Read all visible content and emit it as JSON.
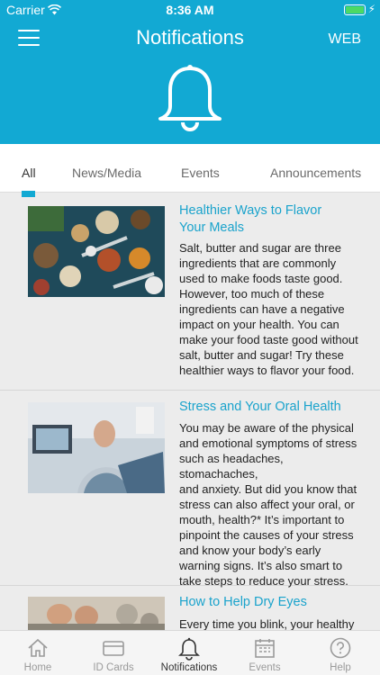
{
  "status_bar": {
    "carrier": "Carrier",
    "time": "8:36 AM"
  },
  "header": {
    "title": "Notifications",
    "web_label": "WEB",
    "colors": {
      "header_bg": "#12a9d3",
      "accent": "#1aa3cc"
    }
  },
  "tabs": [
    {
      "label": "All",
      "active": true
    },
    {
      "label": "News/Media",
      "active": false
    },
    {
      "label": "Events",
      "active": false
    },
    {
      "label": "Announcements",
      "active": false
    }
  ],
  "articles": [
    {
      "title_lines": [
        "Healthier Ways to Flavor",
        "Your Meals"
      ],
      "body_lines": [
        "Salt, butter and sugar are three",
        "ingredients that are commonly",
        "used to make foods taste good.",
        "However, too much of these",
        "ingredients can have a negative",
        "impact on your health. You can",
        "make your food taste good without",
        "salt, butter and sugar! Try these",
        "healthier ways to flavor your food."
      ],
      "image": "spices-photo"
    },
    {
      "title_lines": [
        "Stress and Your Oral Health"
      ],
      "body_lines": [
        "You may be aware of the physical",
        "and emotional symptoms of stress",
        "such as headaches, stomachaches,",
        "and anxiety. But did you know that",
        "stress can also affect your oral, or",
        "mouth, health?* It’s important to",
        "pinpoint the causes of your stress",
        "and know your body’s early",
        "warning signs. It’s also smart to",
        "take steps to reduce your stress."
      ],
      "image": "dental-patient-photo"
    },
    {
      "title_lines": [
        "How to Help Dry Eyes"
      ],
      "body_lines": [
        "Every time you blink, your healthy"
      ],
      "image": "couple-photo"
    }
  ],
  "bottom_nav": [
    {
      "label": "Home",
      "icon": "home-icon",
      "active": false
    },
    {
      "label": "ID Cards",
      "icon": "id-card-icon",
      "active": false
    },
    {
      "label": "Notifications",
      "icon": "bell-icon",
      "active": true
    },
    {
      "label": "Events",
      "icon": "calendar-icon",
      "active": false
    },
    {
      "label": "Help",
      "icon": "help-icon",
      "active": false
    }
  ]
}
